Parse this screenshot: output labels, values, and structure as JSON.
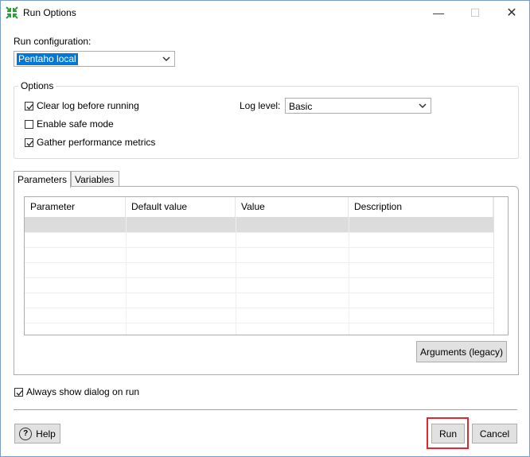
{
  "window": {
    "title": "Run Options",
    "minimize_glyph": "—",
    "maximize_glyph": "☐",
    "close_glyph": "✕"
  },
  "run_configuration": {
    "label": "Run configuration:",
    "selected": "Pentaho local"
  },
  "options": {
    "group_label": "Options",
    "clear_log": {
      "label": "Clear log before running",
      "checked": true
    },
    "safe_mode": {
      "label": "Enable safe mode",
      "checked": false
    },
    "gather_metrics": {
      "label": "Gather performance metrics",
      "checked": true
    },
    "log_level": {
      "label": "Log level:",
      "selected": "Basic"
    }
  },
  "tabs": [
    {
      "label": "Parameters",
      "active": true
    },
    {
      "label": "Variables",
      "active": false
    }
  ],
  "parameters_table": {
    "columns": [
      "Parameter",
      "Default value",
      "Value",
      "Description"
    ],
    "rows": []
  },
  "arguments_button": "Arguments (legacy)",
  "always_show": {
    "label": "Always show dialog on run",
    "checked": true
  },
  "footer": {
    "help_label": "Help",
    "help_icon_glyph": "?",
    "run_label": "Run",
    "cancel_label": "Cancel"
  }
}
